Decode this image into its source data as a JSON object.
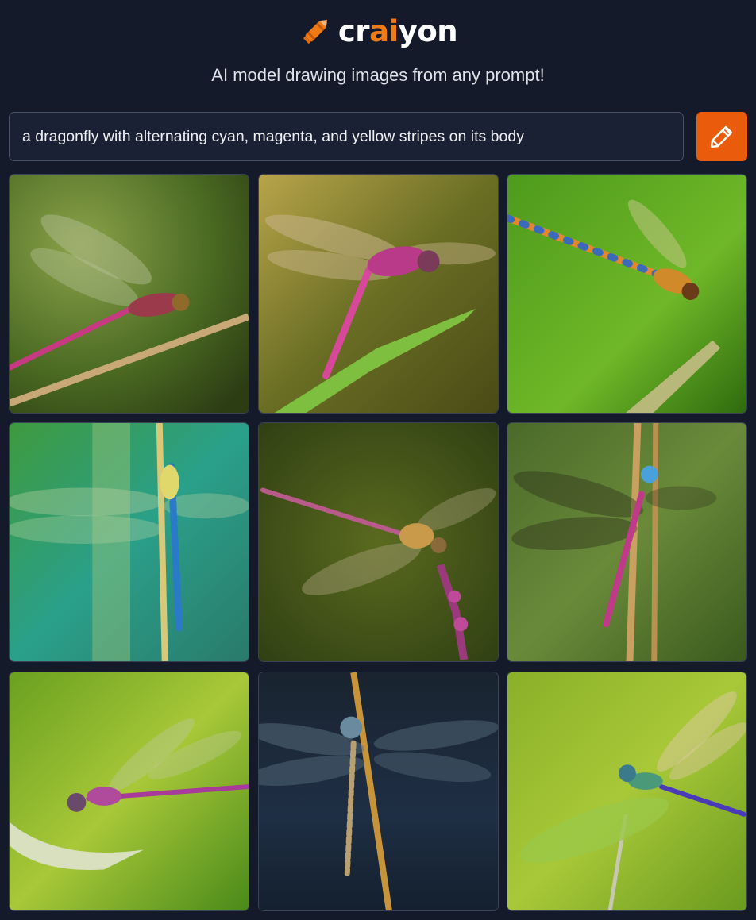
{
  "brand": {
    "name_prefix": "cr",
    "name_accent": "ai",
    "name_suffix": "yon",
    "accent_color": "#f07a16",
    "logo_icon": "crayon-icon"
  },
  "tagline": "AI model drawing images from any prompt!",
  "prompt": {
    "value": "a dragonfly with alternating cyan, magenta, and yellow stripes on its body",
    "button_icon": "pencil-icon",
    "button_color": "#ea5c0c"
  },
  "results": {
    "count": 9,
    "images": [
      {
        "name": "image-1",
        "subject": "dragonfly"
      },
      {
        "name": "image-2",
        "subject": "dragonfly"
      },
      {
        "name": "image-3",
        "subject": "dragonfly"
      },
      {
        "name": "image-4",
        "subject": "dragonfly"
      },
      {
        "name": "image-5",
        "subject": "dragonfly"
      },
      {
        "name": "image-6",
        "subject": "dragonfly"
      },
      {
        "name": "image-7",
        "subject": "dragonfly"
      },
      {
        "name": "image-8",
        "subject": "dragonfly"
      },
      {
        "name": "image-9",
        "subject": "dragonfly"
      }
    ]
  }
}
